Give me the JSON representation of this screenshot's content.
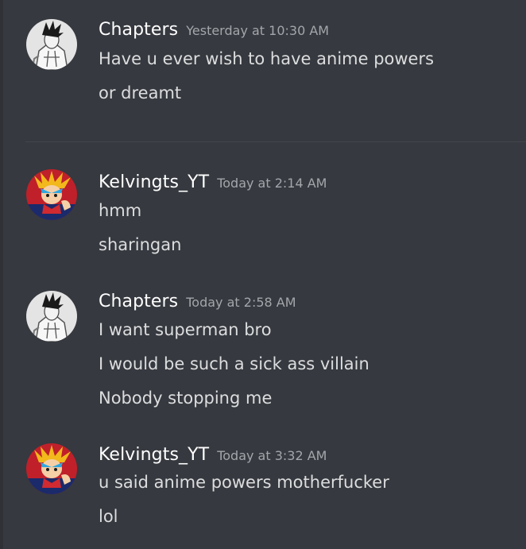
{
  "colors": {
    "background": "#36393f",
    "username": "#ffffff",
    "timestamp": "#a3a6aa",
    "message": "#dcddde",
    "divider": "#42454a"
  },
  "messages": [
    {
      "author": "Chapters",
      "timestamp": "Yesterday at 10:30 AM",
      "avatar_icon": "anime-character-grayscale-avatar",
      "lines": [
        "Have u ever wish to have anime powers",
        "or dreamt"
      ]
    },
    {
      "author": "Kelvingts_YT",
      "timestamp": "Today at 2:14 AM",
      "avatar_icon": "anime-character-color-avatar",
      "lines": [
        "hmm",
        "sharingan"
      ]
    },
    {
      "author": "Chapters",
      "timestamp": "Today at 2:58 AM",
      "avatar_icon": "anime-character-grayscale-avatar",
      "lines": [
        "I want superman bro",
        "I would be such a sick ass villain",
        "Nobody stopping me"
      ]
    },
    {
      "author": "Kelvingts_YT",
      "timestamp": "Today at 3:32 AM",
      "avatar_icon": "anime-character-color-avatar",
      "lines": [
        "u said anime powers motherfucker",
        "lol"
      ]
    }
  ]
}
